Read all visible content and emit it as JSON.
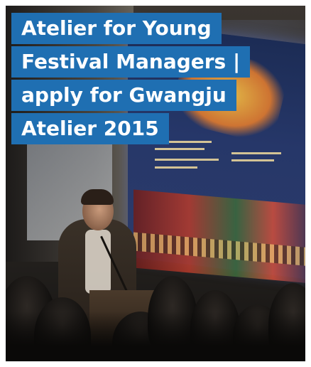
{
  "card": {
    "title_lines": [
      "Atelier for Young",
      "Festival Managers |",
      "apply for Gwangju",
      "Atelier 2015"
    ],
    "title_bg": "#1f6fb2",
    "title_color": "#ffffff"
  }
}
